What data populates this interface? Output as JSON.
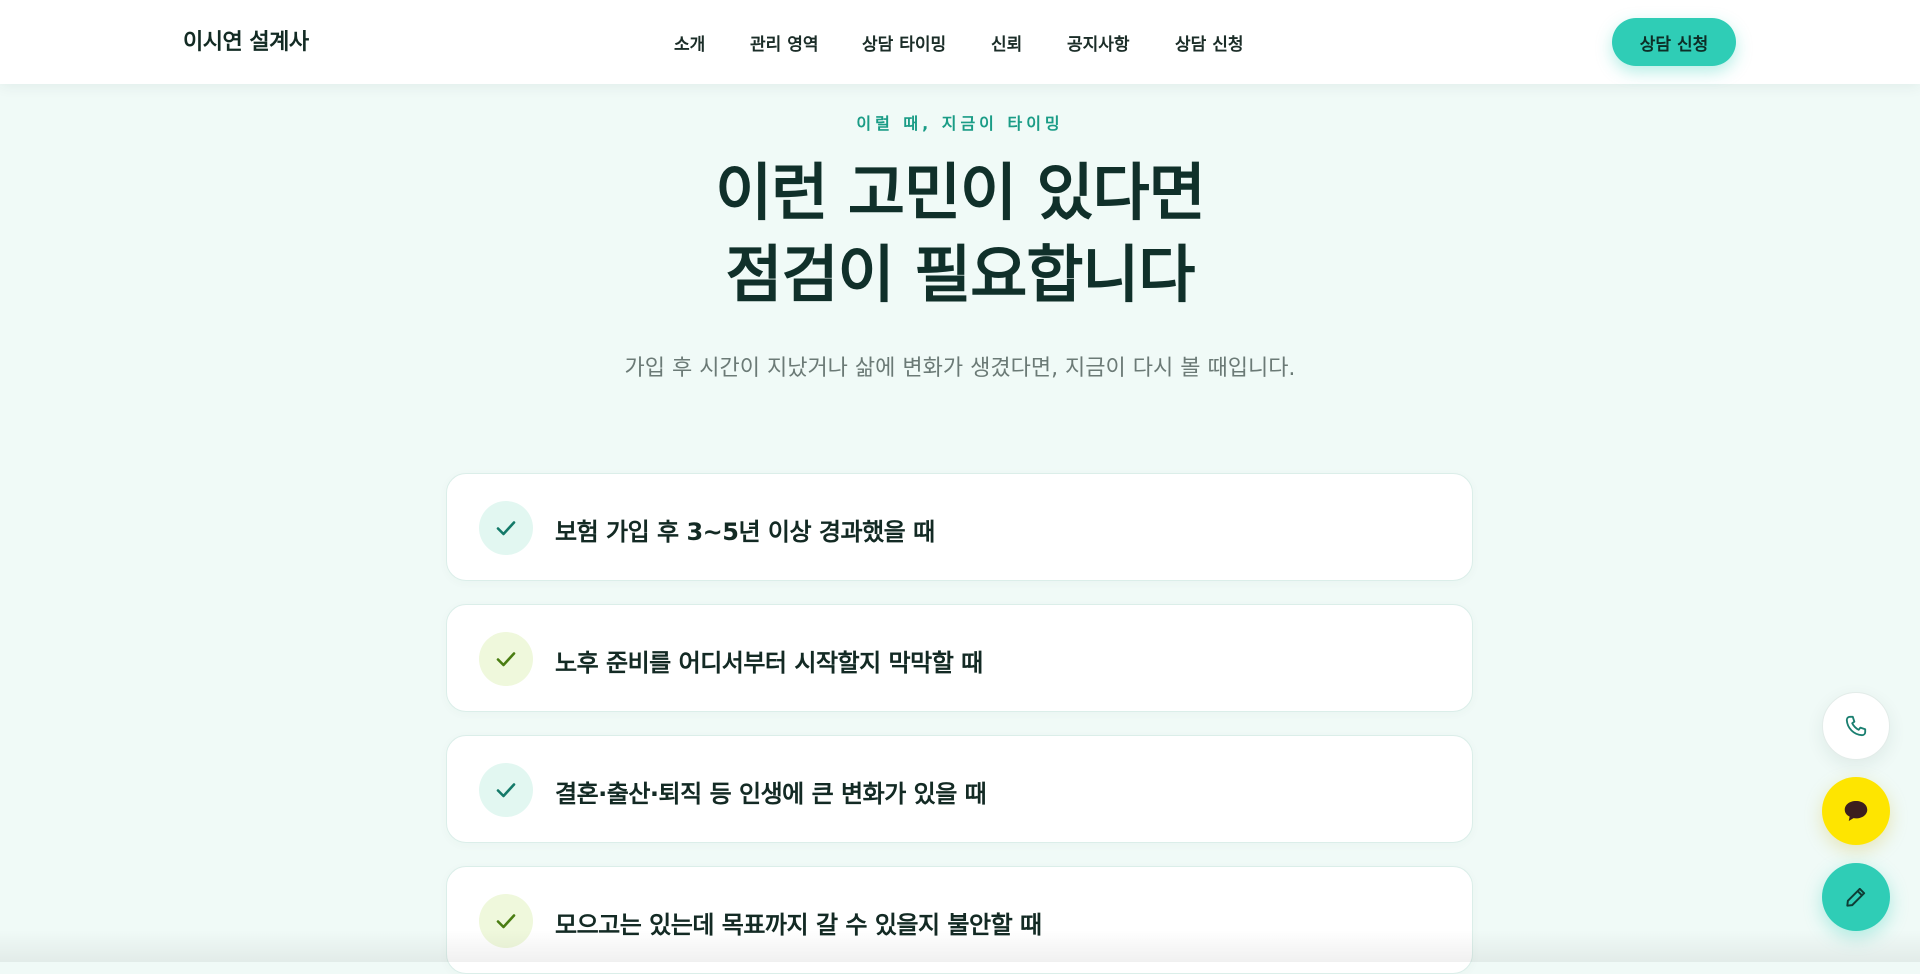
{
  "header": {
    "logo": "이시연 설계사",
    "nav": [
      "소개",
      "관리 영역",
      "상담 타이밍",
      "신뢰",
      "공지사항",
      "상담 신청"
    ],
    "cta": "상담 신청"
  },
  "hero": {
    "eyebrow": "이럴 때, 지금이 타이밍",
    "title_line1": "이런 고민이 있다면",
    "title_line2": "점검이 필요합니다",
    "subtitle": "가입 후 시간이 지났거나 삶에 변화가 생겼다면, 지금이 다시 볼 때입니다."
  },
  "items": [
    {
      "text": "보험 가입 후 3~5년 이상 경과했을 때",
      "accent": "#e2f7f1",
      "icon": "check-icon"
    },
    {
      "text": "노후 준비를 어디서부터 시작할지 막막할 때",
      "accent": "#eff8dc",
      "icon": "check-icon"
    },
    {
      "text": "결혼·출산·퇴직 등 인생에 큰 변화가 있을 때",
      "accent": "#e2f7f1",
      "icon": "check-icon"
    },
    {
      "text": "모으고는 있는데 목표까지 갈 수 있을지 불안할 때",
      "accent": "#eff8dc",
      "icon": "check-icon"
    }
  ],
  "floating": {
    "phone_icon": "phone-icon",
    "chat_icon": "chat-bubble-icon",
    "write_icon": "pencil-icon"
  },
  "colors": {
    "accent": "#2fcdb6",
    "background": "#f0faf7",
    "kakao": "#fee500",
    "text_dark": "#10302a"
  }
}
